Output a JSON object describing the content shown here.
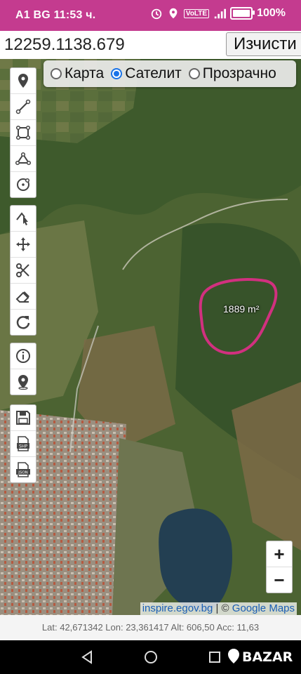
{
  "status": {
    "carrier": "A1 BG",
    "time": "11:53 ч.",
    "battery": "100%",
    "icons": [
      "alarm-icon",
      "location-icon",
      "volte-icon",
      "signal-4g-icon",
      "battery-icon"
    ]
  },
  "search": {
    "value": "12259.1138.679",
    "clear_label": "Изчисти"
  },
  "layers": {
    "options": [
      "Карта",
      "Сателит",
      "Прозрачно"
    ],
    "selected": "Сателит"
  },
  "tools": {
    "draw": [
      "marker-icon",
      "polyline-icon",
      "rectangle-icon",
      "polygon-icon",
      "circle-icon"
    ],
    "edit": [
      "edit-vertex-icon",
      "move-icon",
      "cut-icon",
      "eraser-icon",
      "rotate-icon"
    ],
    "info": [
      "info-icon",
      "locate-icon"
    ],
    "export": [
      "save-icon",
      "shp-export-icon",
      "json-export-icon"
    ],
    "shp_label": "SHP",
    "json_label": "JSON"
  },
  "map": {
    "area_label": "1889 m²",
    "attribution_link": "inspire.egov.bg",
    "attribution_sep": " | © ",
    "attribution_maps": "Google Maps",
    "zoom_in": "+",
    "zoom_out": "−"
  },
  "coords": {
    "text": "Lat: 42,671342 Lon: 23,361417 Alt: 606,50 Acc: 11,63"
  },
  "nav": {
    "watermark": "BAZAR"
  },
  "colors": {
    "statusbar": "#c43b8f",
    "outline": "#d1307f",
    "accent": "#1a73e8"
  }
}
